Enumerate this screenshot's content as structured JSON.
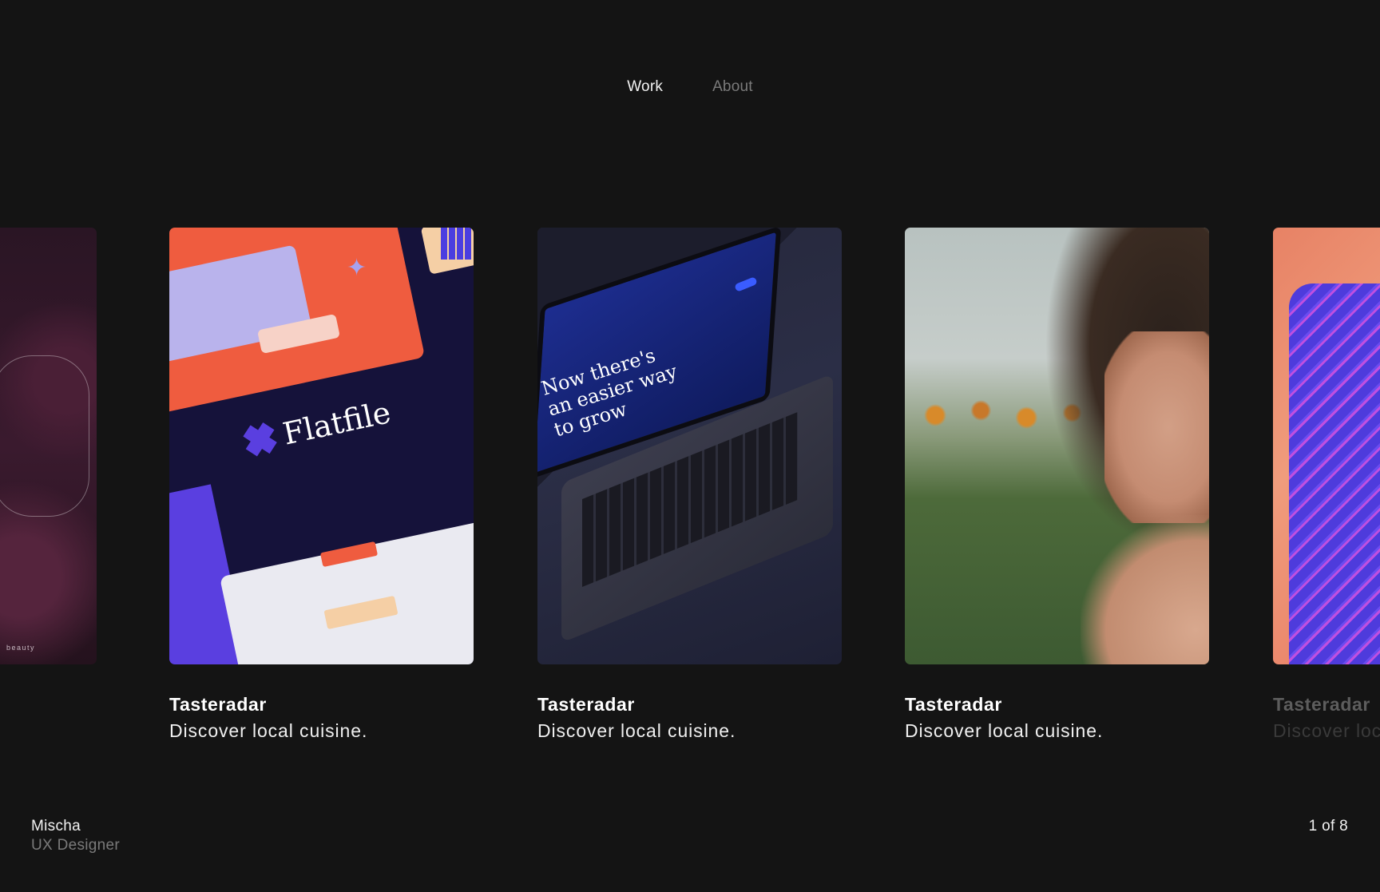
{
  "nav": {
    "items": [
      {
        "label": "Work",
        "active": true
      },
      {
        "label": "About",
        "active": false
      }
    ]
  },
  "projects": [
    {
      "title": "",
      "subtitle": "",
      "image": "peony-flowers-image",
      "caption": "beauty"
    },
    {
      "title": "Tasteradar",
      "subtitle": "Discover local cuisine.",
      "image": "flatfile-brand-collage-image",
      "image_text": "Flatfile"
    },
    {
      "title": "Tasteradar",
      "subtitle": "Discover local cuisine.",
      "image": "laptop-website-mockup-image",
      "image_text": "Now there's an easier way to grow"
    },
    {
      "title": "Tasteradar",
      "subtitle": "Discover local cuisine.",
      "image": "woman-sunflower-field-image"
    },
    {
      "title": "Tasteradar",
      "subtitle": "Discover local cuisine.",
      "image": "abstract-3d-gradient-image"
    }
  ],
  "footer": {
    "name": "Mischa",
    "role": "UX Designer"
  },
  "pager": {
    "text": "1 of 8",
    "current": 1,
    "total": 8
  },
  "colors": {
    "background": "#141414",
    "text_primary": "#ffffff",
    "text_muted": "#7a7a7a"
  }
}
